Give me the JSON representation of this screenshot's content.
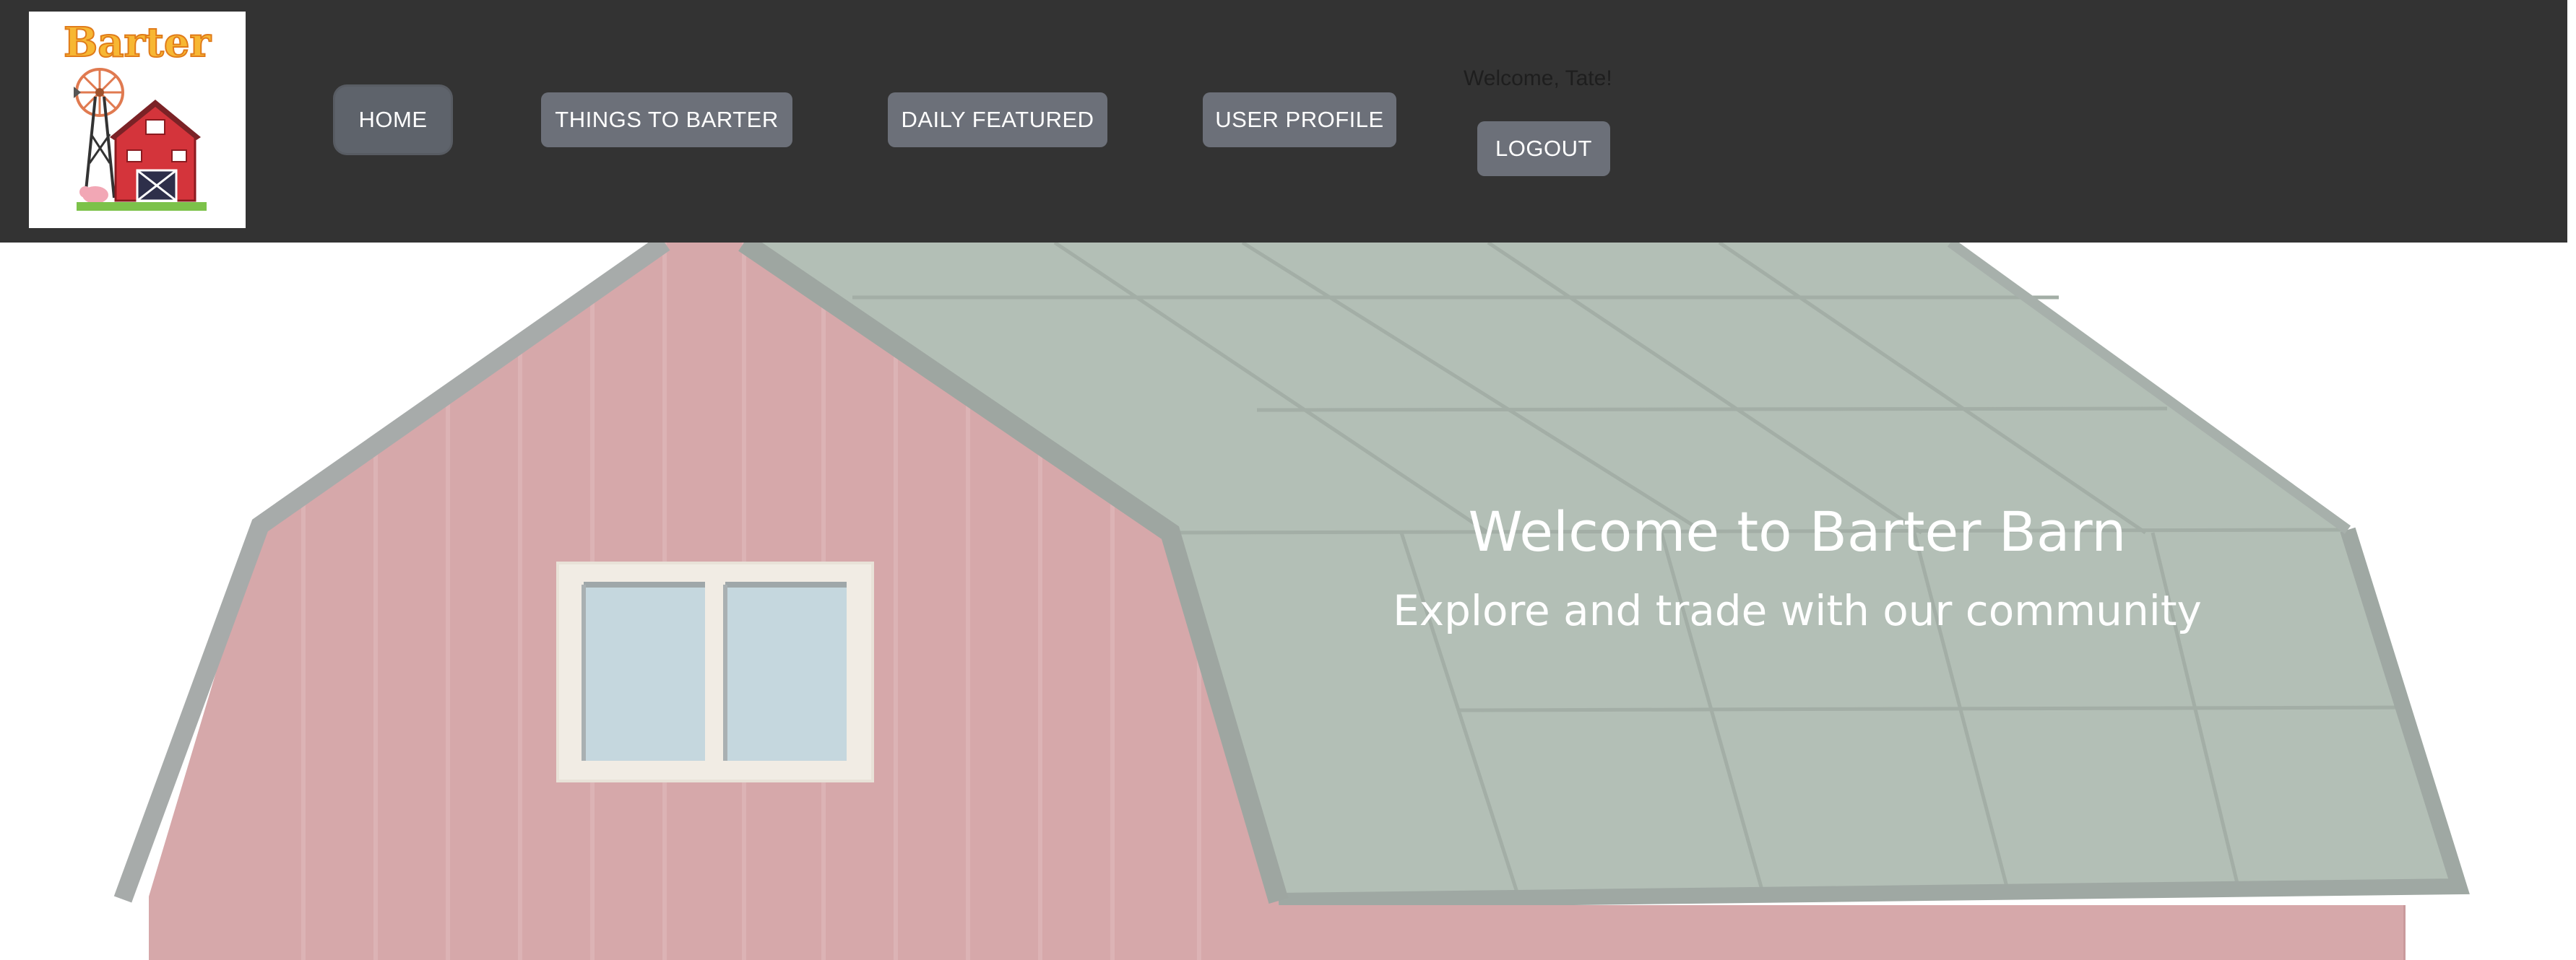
{
  "app": {
    "logo_text": "Barter"
  },
  "nav": {
    "home_label": "HOME",
    "things_label": "THINGS TO BARTER",
    "daily_label": "DAILY FEATURED",
    "profile_label": "USER PROFILE",
    "logout_label": "LOGOUT",
    "welcome_text": "Welcome, Tate!"
  },
  "hero": {
    "title": "Welcome to Barter Barn",
    "subtitle": "Explore and trade with our community"
  },
  "colors": {
    "navbar": "#333333",
    "button": "#6c7079",
    "barn_red": "#d6a8aa",
    "roof_green": "#b3bfb6",
    "roof_trim": "#9fa8a3"
  },
  "icons": [
    "barter-logo",
    "barn-illustration"
  ]
}
